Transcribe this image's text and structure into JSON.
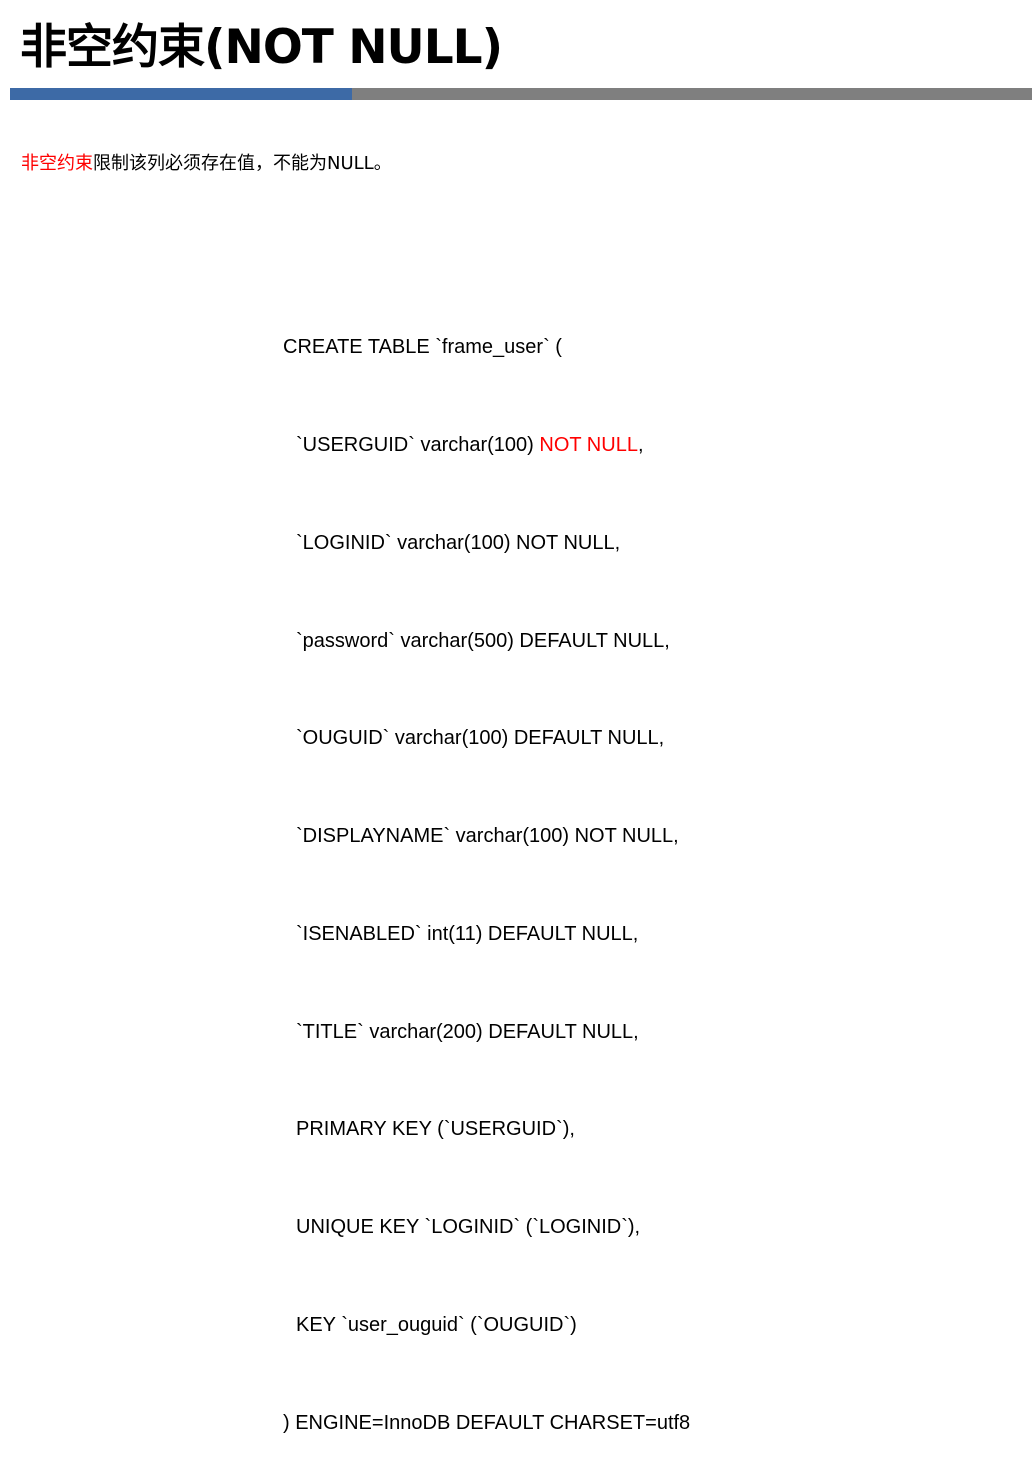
{
  "title": "非空约束(NOT NULL)",
  "intro": {
    "highlight": "非空约束",
    "rest": "限制该列必须存在值，不能为NULL。"
  },
  "code": {
    "line1": "CREATE TABLE `frame_user` (",
    "line2_prefix": "`USERGUID` varchar(100) ",
    "line2_highlight": "NOT NULL",
    "line2_suffix": ",",
    "line3": "`LOGINID` varchar(100) NOT NULL,",
    "line4": "`password` varchar(500) DEFAULT NULL,",
    "line5": "`OUGUID` varchar(100) DEFAULT NULL,",
    "line6": "`DISPLAYNAME` varchar(100) NOT NULL,",
    "line7": "`ISENABLED` int(11) DEFAULT NULL,",
    "line8": "`TITLE` varchar(200) DEFAULT NULL,",
    "line9": "PRIMARY KEY (`USERGUID`),",
    "line10": "UNIQUE KEY `LOGINID` (`LOGINID`),",
    "line11": "KEY `user_ouguid` (`OUGUID`)",
    "line12": ") ENGINE=InnoDB DEFAULT CHARSET=utf8"
  },
  "colors": {
    "accent_red": "#ff0000",
    "bar_blue": "#3d6aa6",
    "bar_gray": "#7f7f7f"
  }
}
